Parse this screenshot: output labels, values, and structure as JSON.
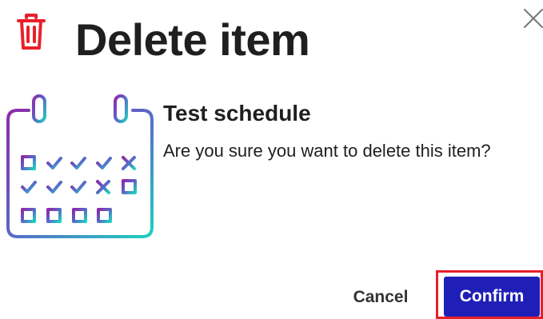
{
  "dialog": {
    "title": "Delete item",
    "item_name": "Test schedule",
    "message": "Are you sure you want to delete this item?",
    "cancel_label": "Cancel",
    "confirm_label": "Confirm"
  },
  "icons": {
    "header": "trash-icon",
    "close": "close-icon",
    "illustration": "calendar-checklist-icon"
  },
  "colors": {
    "danger": "#e8202a",
    "primary": "#1f1fb8",
    "text": "#1f1f1f",
    "illustration_gradient": [
      "#8e2aa8",
      "#5a68c8",
      "#1fd0c0"
    ]
  }
}
